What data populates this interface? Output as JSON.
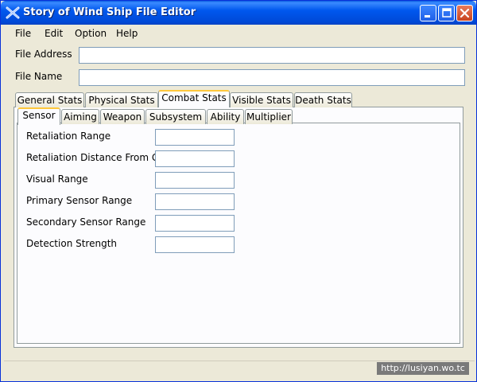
{
  "window": {
    "title": "Story of Wind Ship File Editor",
    "title_icon": "crossed-ships-icon"
  },
  "menu": [
    "File",
    "Edit",
    "Option",
    "Help"
  ],
  "fields": {
    "file_address": {
      "label": "File Address",
      "value": ""
    },
    "file_name": {
      "label": "File Name",
      "value": ""
    }
  },
  "outer_tabs": [
    "General Stats",
    "Physical Stats",
    "Combat Stats",
    "Visible Stats",
    "Death Stats"
  ],
  "outer_tabs_selected": "Combat Stats",
  "inner_tabs": [
    "Sensor",
    "Aiming",
    "Weapon",
    "Subsystem",
    "Ability",
    "Multiplier"
  ],
  "inner_tabs_selected": "Sensor",
  "sensor_rows": [
    {
      "label": "Retaliation Range",
      "value": ""
    },
    {
      "label": "Retaliation Distance From Go",
      "value": ""
    },
    {
      "label": "Visual Range",
      "value": ""
    },
    {
      "label": "Primary Sensor Range",
      "value": ""
    },
    {
      "label": "Secondary Sensor Range",
      "value": ""
    },
    {
      "label": "Detection Strength",
      "value": ""
    }
  ],
  "watermark": "http://lusiyan.wo.tc",
  "colors": {
    "title_bar": "#0058ee",
    "close_button": "#c8431f",
    "active_tab_accent": "#ffc83c",
    "window_bg": "#ece9d8"
  }
}
